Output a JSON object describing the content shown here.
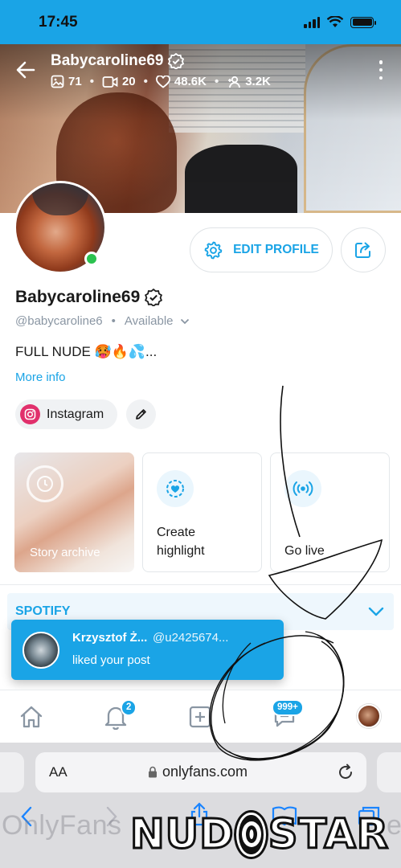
{
  "status_bar": {
    "time": "17:45"
  },
  "cover": {
    "username": "Babycaroline69",
    "stats": {
      "photos": "71",
      "videos": "20",
      "likes": "48.6K",
      "fans": "3.2K"
    }
  },
  "profile": {
    "edit_label": "EDIT PROFILE",
    "display_name": "Babycaroline69",
    "handle": "@babycaroline6",
    "availability": "Available",
    "bio": "FULL NUDE 🥵🔥💦...",
    "more_info": "More info",
    "instagram_label": "Instagram"
  },
  "highlights": [
    {
      "label": "Story archive"
    },
    {
      "label": "Create\nhighlight"
    },
    {
      "label": "Go live"
    }
  ],
  "spotify": {
    "label": "SPOTIFY"
  },
  "notification": {
    "name": "Krzysztof Ż...",
    "handle": "@u2425674...",
    "message": "liked your post"
  },
  "bottom_nav": {
    "notifications_badge": "2",
    "messages_badge": "999+"
  },
  "browser": {
    "aa_label": "AA",
    "url": "onlyfans.com"
  },
  "watermark": {
    "text": "OnlyFans",
    "tail": "e",
    "logo": "NUDOSTAR"
  },
  "colors": {
    "accent": "#1aa4e6",
    "online": "#2bc24f",
    "instagram": "#e1306c"
  }
}
